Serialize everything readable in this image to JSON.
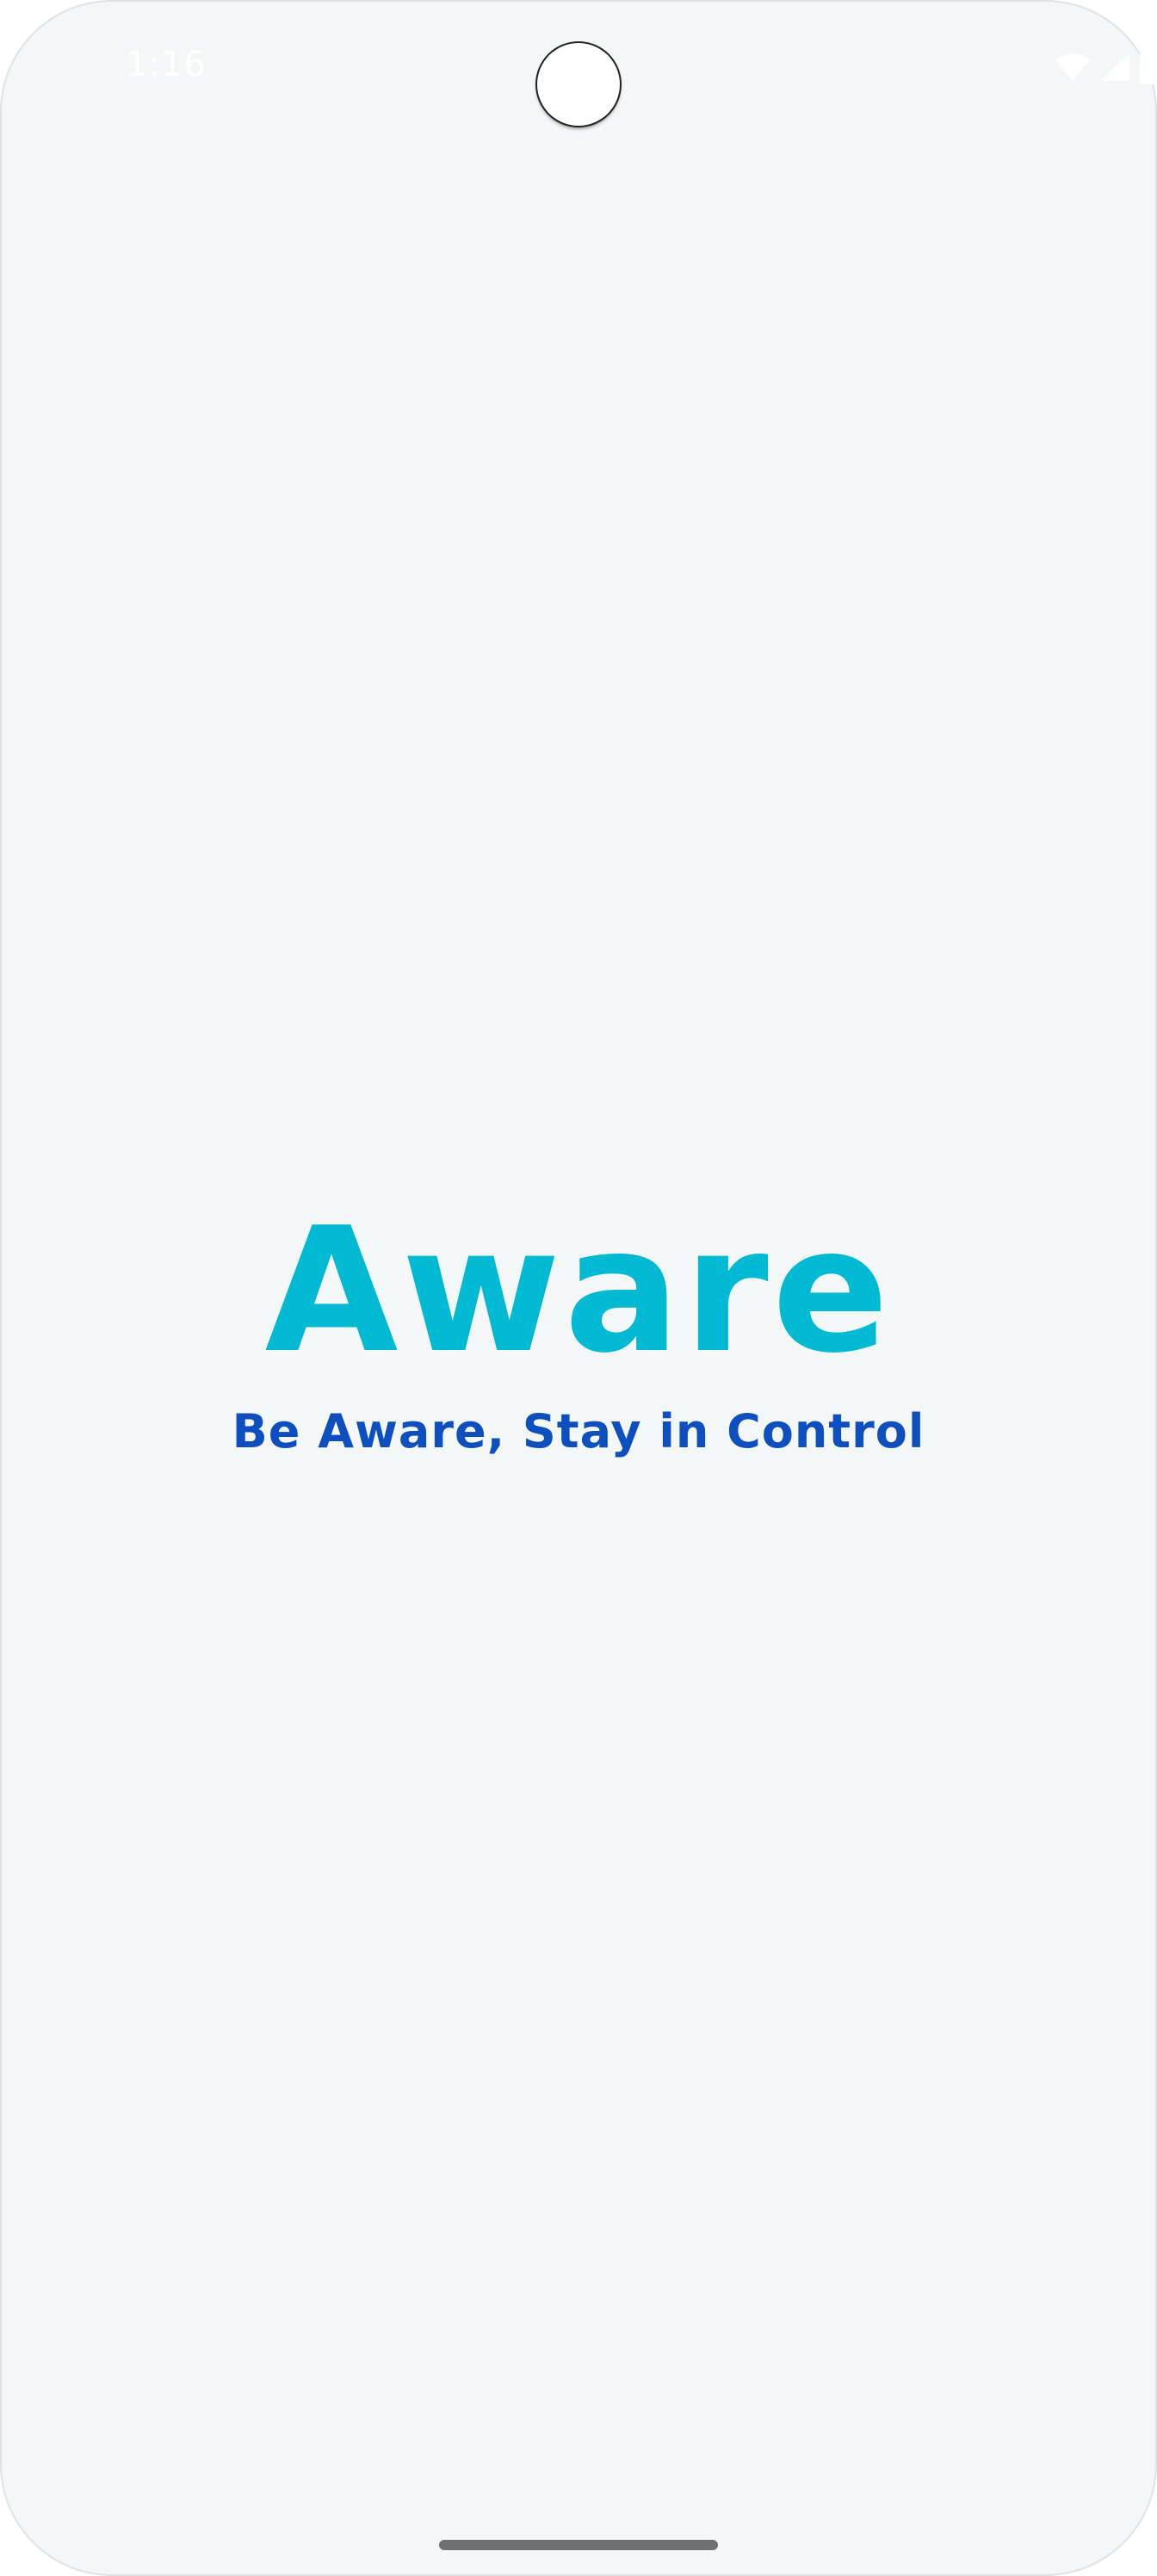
{
  "status_bar": {
    "time": "1:16",
    "icons": [
      "wifi-icon",
      "signal-icon",
      "battery-icon"
    ]
  },
  "splash": {
    "app_name": "Aware",
    "tagline": "Be Aware, Stay in Control"
  },
  "colors": {
    "background": "#f4f7f8",
    "app_name": "#00b9d2",
    "tagline": "#0d4fbe",
    "home_indicator": "#6d6f71"
  }
}
